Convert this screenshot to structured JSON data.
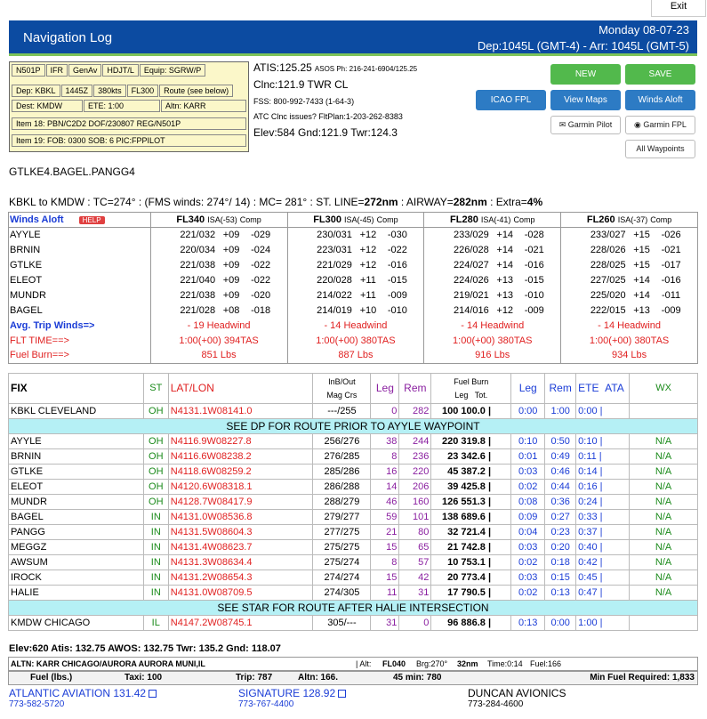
{
  "header": {
    "exit": "Exit",
    "title": "Navigation Log",
    "date": "Monday 08-07-23",
    "times": "Dep:1045L (GMT-4) - Arr: 1045L (GMT-5)"
  },
  "flight": {
    "tail": "N501P",
    "rules": "IFR",
    "type": "GenAv",
    "aircraft": "HDJT/L",
    "equip": "Equip: SGRW/P",
    "dep": "Dep: KBKL",
    "time": "1445Z",
    "speed": "380kts",
    "alt": "FL300",
    "route_note": "Route (see below)",
    "dest": "Dest: KMDW",
    "ete": "ETE: 1:00",
    "altn": "Altn: KARR",
    "item18": "Item 18: PBN/C2D2 DOF/230807 REG/N501P",
    "item19": "Item 19:  FOB: 0300  SOB: 6  PIC:FPPILOT"
  },
  "freqs": {
    "atis": "ATIS:125.25",
    "asos": "ASOS Ph: 216-241-6904/125.25",
    "clnc": "Clnc:121.9 TWR CL",
    "fss": "FSS: 800-992-7433 (1-64-3)",
    "atc": "ATC Clnc issues? FltPlan:1-203-262-8383",
    "elev": "Elev:584  Gnd:121.9  Twr:124.3"
  },
  "buttons": {
    "new": "NEW",
    "save": "SAVE",
    "icao": "ICAO FPL",
    "maps": "View Maps",
    "winds": "Winds Aloft",
    "garmin_pilot": "Garmin Pilot",
    "garmin_fpl": "Garmin FPL",
    "waypoints": "All Waypoints"
  },
  "route": "GTLKE4.BAGEL.PANGG4",
  "summary": {
    "pre": "KBKL to KMDW : TC=274° : (FMS winds: 274°/ 14) : MC= 281° : ST. LINE=",
    "st": "272nm",
    "mid": " : AIRWAY=",
    "aw": "282nm",
    "post": " : Extra=",
    "extra": "4%"
  },
  "winds": {
    "label": "Winds Aloft",
    "help": "HELP",
    "levels": [
      {
        "fl": "FL340",
        "isa": "ISA(-53)",
        "comp": "Comp"
      },
      {
        "fl": "FL300",
        "isa": "ISA(-45)",
        "comp": "Comp"
      },
      {
        "fl": "FL280",
        "isa": "ISA(-41)",
        "comp": "Comp"
      },
      {
        "fl": "FL260",
        "isa": "ISA(-37)",
        "comp": "Comp"
      }
    ],
    "rows": [
      {
        "fix": "AYYLE",
        "v": [
          [
            "221/032",
            "+09",
            "-029"
          ],
          [
            "230/031",
            "+12",
            "-030"
          ],
          [
            "233/029",
            "+14",
            "-028"
          ],
          [
            "233/027",
            "+15",
            "-026"
          ]
        ]
      },
      {
        "fix": "BRNIN",
        "v": [
          [
            "220/034",
            "+09",
            "-024"
          ],
          [
            "223/031",
            "+12",
            "-022"
          ],
          [
            "226/028",
            "+14",
            "-021"
          ],
          [
            "228/026",
            "+15",
            "-021"
          ]
        ]
      },
      {
        "fix": "GTLKE",
        "v": [
          [
            "221/038",
            "+09",
            "-022"
          ],
          [
            "221/029",
            "+12",
            "-016"
          ],
          [
            "224/027",
            "+14",
            "-016"
          ],
          [
            "228/025",
            "+15",
            "-017"
          ]
        ]
      },
      {
        "fix": "ELEOT",
        "v": [
          [
            "221/040",
            "+09",
            "-022"
          ],
          [
            "220/028",
            "+11",
            "-015"
          ],
          [
            "224/026",
            "+13",
            "-015"
          ],
          [
            "227/025",
            "+14",
            "-016"
          ]
        ]
      },
      {
        "fix": "MUNDR",
        "v": [
          [
            "221/038",
            "+09",
            "-020"
          ],
          [
            "214/022",
            "+11",
            "-009"
          ],
          [
            "219/021",
            "+13",
            "-010"
          ],
          [
            "225/020",
            "+14",
            "-011"
          ]
        ]
      },
      {
        "fix": "BAGEL",
        "v": [
          [
            "221/028",
            "+08",
            "-018"
          ],
          [
            "214/019",
            "+10",
            "-010"
          ],
          [
            "214/016",
            "+12",
            "-009"
          ],
          [
            "222/015",
            "+13",
            "-009"
          ]
        ]
      }
    ],
    "avg_label": "Avg. Trip Winds=>",
    "avg": [
      "- 19 Headwind",
      "- 14 Headwind",
      "- 14 Headwind",
      "- 14 Headwind"
    ],
    "flt_label": "FLT TIME==>",
    "flt": [
      "1:00(+00)  394TAS",
      "1:00(+00)  380TAS",
      "1:00(+00)  380TAS",
      "1:00(+00)  380TAS"
    ],
    "fuel_label": "Fuel Burn==>",
    "fuel": [
      "851 Lbs",
      "887 Lbs",
      "916 Lbs",
      "934 Lbs"
    ]
  },
  "fixes": {
    "h": {
      "fix": "FIX",
      "st": "ST",
      "latlon": "LAT/LON",
      "inb": "InB/Out",
      "mag": "Mag Crs",
      "leg": "Leg",
      "rem": "Rem",
      "fb": "Fuel Burn",
      "fbleg": "Leg",
      "fbtot": "Tot.",
      "leg2": "Leg",
      "rem2": "Rem",
      "ete": "ETE",
      "ata": "ATA",
      "wx": "WX"
    },
    "start": {
      "fix": "KBKL CLEVELAND",
      "st": "OH",
      "ll": "N4131.1W08141.0",
      "crs": "---/255",
      "leg": "0",
      "rem": "282",
      "fb": "100",
      "tot": "100.0 |",
      "l2": "0:00",
      "r2": "1:00",
      "ete": "0:00 |",
      "wx": ""
    },
    "dp": "SEE DP FOR ROUTE PRIOR TO AYYLE WAYPOINT",
    "rows": [
      {
        "fix": "AYYLE",
        "st": "OH",
        "ll": "N4116.9W08227.8",
        "crs": "256/276",
        "leg": "38",
        "rem": "244",
        "fb": "220",
        "tot": "319.8 |",
        "l2": "0:10",
        "r2": "0:50",
        "ete": "0:10 |",
        "wx": "N/A"
      },
      {
        "fix": "BRNIN",
        "st": "OH",
        "ll": "N4116.6W08238.2",
        "crs": "276/285",
        "leg": "8",
        "rem": "236",
        "fb": "23",
        "tot": "342.6 |",
        "l2": "0:01",
        "r2": "0:49",
        "ete": "0:11 |",
        "wx": "N/A"
      },
      {
        "fix": "GTLKE",
        "st": "OH",
        "ll": "N4118.6W08259.2",
        "crs": "285/286",
        "leg": "16",
        "rem": "220",
        "fb": "45",
        "tot": "387.2 |",
        "l2": "0:03",
        "r2": "0:46",
        "ete": "0:14 |",
        "wx": "N/A"
      },
      {
        "fix": "ELEOT",
        "st": "OH",
        "ll": "N4120.6W08318.1",
        "crs": "286/288",
        "leg": "14",
        "rem": "206",
        "fb": "39",
        "tot": "425.8 |",
        "l2": "0:02",
        "r2": "0:44",
        "ete": "0:16 |",
        "wx": "N/A"
      },
      {
        "fix": "MUNDR",
        "st": "OH",
        "ll": "N4128.7W08417.9",
        "crs": "288/279",
        "leg": "46",
        "rem": "160",
        "fb": "126",
        "tot": "551.3 |",
        "l2": "0:08",
        "r2": "0:36",
        "ete": "0:24 |",
        "wx": "N/A"
      },
      {
        "fix": "BAGEL",
        "st": "IN",
        "ll": "N4131.0W08536.8",
        "crs": "279/277",
        "leg": "59",
        "rem": "101",
        "fb": "138",
        "tot": "689.6 |",
        "l2": "0:09",
        "r2": "0:27",
        "ete": "0:33 |",
        "wx": "N/A"
      },
      {
        "fix": "PANGG",
        "st": "IN",
        "ll": "N4131.5W08604.3",
        "crs": "277/275",
        "leg": "21",
        "rem": "80",
        "fb": "32",
        "tot": "721.4 |",
        "l2": "0:04",
        "r2": "0:23",
        "ete": "0:37 |",
        "wx": "N/A"
      },
      {
        "fix": "MEGGZ",
        "st": "IN",
        "ll": "N4131.4W08623.7",
        "crs": "275/275",
        "leg": "15",
        "rem": "65",
        "fb": "21",
        "tot": "742.8 |",
        "l2": "0:03",
        "r2": "0:20",
        "ete": "0:40 |",
        "wx": "N/A"
      },
      {
        "fix": "AWSUM",
        "st": "IN",
        "ll": "N4131.3W08634.4",
        "crs": "275/274",
        "leg": "8",
        "rem": "57",
        "fb": "10",
        "tot": "753.1 |",
        "l2": "0:02",
        "r2": "0:18",
        "ete": "0:42 |",
        "wx": "N/A"
      },
      {
        "fix": "IROCK",
        "st": "IN",
        "ll": "N4131.2W08654.3",
        "crs": "274/274",
        "leg": "15",
        "rem": "42",
        "fb": "20",
        "tot": "773.4 |",
        "l2": "0:03",
        "r2": "0:15",
        "ete": "0:45 |",
        "wx": "N/A"
      },
      {
        "fix": "HALIE",
        "st": "IN",
        "ll": "N4131.0W08709.5",
        "crs": "274/305",
        "leg": "11",
        "rem": "31",
        "fb": "17",
        "tot": "790.5 |",
        "l2": "0:02",
        "r2": "0:13",
        "ete": "0:47 |",
        "wx": "N/A"
      }
    ],
    "star": "SEE STAR FOR ROUTE AFTER HALIE INTERSECTION",
    "end": {
      "fix": "KMDW CHICAGO",
      "st": "IL",
      "ll": "N4147.2W08745.1",
      "crs": "305/---",
      "leg": "31",
      "rem": "0",
      "fb": "96",
      "tot": "886.8 |",
      "l2": "0:13",
      "r2": "0:00",
      "ete": "1:00 |",
      "wx": ""
    }
  },
  "dest_info": "Elev:620  Atis: 132.75  AWOS: 132.75  Twr: 135.2  Gnd: 118.07",
  "altn": {
    "name": "ALTN: KARR CHICAGO/AURORA AURORA MUNI,IL",
    "alt": "| Alt: ",
    "altv": "FL040",
    "brg": "Brg:270°",
    "dist": "32nm",
    "time": "Time:0:14",
    "fuel": "Fuel:166"
  },
  "fuel": {
    "label": "Fuel (lbs.)",
    "taxi": "Taxi: 100",
    "trip": "Trip: 787",
    "altn": "Altn: 166.",
    "res": "45 min: 780",
    "min": "Min Fuel Required: 1,833"
  },
  "fbos": [
    {
      "name": "ATLANTIC AVIATION 131.42",
      "phone": "773-582-5720"
    },
    {
      "name": "SIGNATURE 128.92",
      "phone": "773-767-4400"
    },
    {
      "name": "DUNCAN AVIONICS",
      "phone": "773-284-4600"
    }
  ]
}
